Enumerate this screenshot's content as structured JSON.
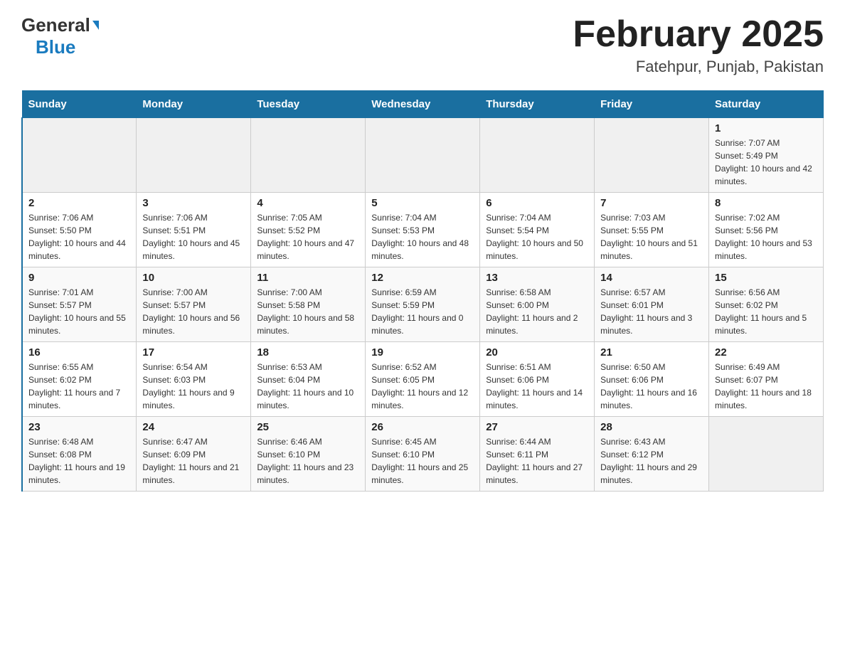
{
  "header": {
    "logo_line1": "General",
    "logo_line2": "Blue",
    "title": "February 2025",
    "subtitle": "Fatehpur, Punjab, Pakistan"
  },
  "calendar": {
    "days_of_week": [
      "Sunday",
      "Monday",
      "Tuesday",
      "Wednesday",
      "Thursday",
      "Friday",
      "Saturday"
    ],
    "weeks": [
      [
        {
          "day": "",
          "sunrise": "",
          "sunset": "",
          "daylight": ""
        },
        {
          "day": "",
          "sunrise": "",
          "sunset": "",
          "daylight": ""
        },
        {
          "day": "",
          "sunrise": "",
          "sunset": "",
          "daylight": ""
        },
        {
          "day": "",
          "sunrise": "",
          "sunset": "",
          "daylight": ""
        },
        {
          "day": "",
          "sunrise": "",
          "sunset": "",
          "daylight": ""
        },
        {
          "day": "",
          "sunrise": "",
          "sunset": "",
          "daylight": ""
        },
        {
          "day": "1",
          "sunrise": "Sunrise: 7:07 AM",
          "sunset": "Sunset: 5:49 PM",
          "daylight": "Daylight: 10 hours and 42 minutes."
        }
      ],
      [
        {
          "day": "2",
          "sunrise": "Sunrise: 7:06 AM",
          "sunset": "Sunset: 5:50 PM",
          "daylight": "Daylight: 10 hours and 44 minutes."
        },
        {
          "day": "3",
          "sunrise": "Sunrise: 7:06 AM",
          "sunset": "Sunset: 5:51 PM",
          "daylight": "Daylight: 10 hours and 45 minutes."
        },
        {
          "day": "4",
          "sunrise": "Sunrise: 7:05 AM",
          "sunset": "Sunset: 5:52 PM",
          "daylight": "Daylight: 10 hours and 47 minutes."
        },
        {
          "day": "5",
          "sunrise": "Sunrise: 7:04 AM",
          "sunset": "Sunset: 5:53 PM",
          "daylight": "Daylight: 10 hours and 48 minutes."
        },
        {
          "day": "6",
          "sunrise": "Sunrise: 7:04 AM",
          "sunset": "Sunset: 5:54 PM",
          "daylight": "Daylight: 10 hours and 50 minutes."
        },
        {
          "day": "7",
          "sunrise": "Sunrise: 7:03 AM",
          "sunset": "Sunset: 5:55 PM",
          "daylight": "Daylight: 10 hours and 51 minutes."
        },
        {
          "day": "8",
          "sunrise": "Sunrise: 7:02 AM",
          "sunset": "Sunset: 5:56 PM",
          "daylight": "Daylight: 10 hours and 53 minutes."
        }
      ],
      [
        {
          "day": "9",
          "sunrise": "Sunrise: 7:01 AM",
          "sunset": "Sunset: 5:57 PM",
          "daylight": "Daylight: 10 hours and 55 minutes."
        },
        {
          "day": "10",
          "sunrise": "Sunrise: 7:00 AM",
          "sunset": "Sunset: 5:57 PM",
          "daylight": "Daylight: 10 hours and 56 minutes."
        },
        {
          "day": "11",
          "sunrise": "Sunrise: 7:00 AM",
          "sunset": "Sunset: 5:58 PM",
          "daylight": "Daylight: 10 hours and 58 minutes."
        },
        {
          "day": "12",
          "sunrise": "Sunrise: 6:59 AM",
          "sunset": "Sunset: 5:59 PM",
          "daylight": "Daylight: 11 hours and 0 minutes."
        },
        {
          "day": "13",
          "sunrise": "Sunrise: 6:58 AM",
          "sunset": "Sunset: 6:00 PM",
          "daylight": "Daylight: 11 hours and 2 minutes."
        },
        {
          "day": "14",
          "sunrise": "Sunrise: 6:57 AM",
          "sunset": "Sunset: 6:01 PM",
          "daylight": "Daylight: 11 hours and 3 minutes."
        },
        {
          "day": "15",
          "sunrise": "Sunrise: 6:56 AM",
          "sunset": "Sunset: 6:02 PM",
          "daylight": "Daylight: 11 hours and 5 minutes."
        }
      ],
      [
        {
          "day": "16",
          "sunrise": "Sunrise: 6:55 AM",
          "sunset": "Sunset: 6:02 PM",
          "daylight": "Daylight: 11 hours and 7 minutes."
        },
        {
          "day": "17",
          "sunrise": "Sunrise: 6:54 AM",
          "sunset": "Sunset: 6:03 PM",
          "daylight": "Daylight: 11 hours and 9 minutes."
        },
        {
          "day": "18",
          "sunrise": "Sunrise: 6:53 AM",
          "sunset": "Sunset: 6:04 PM",
          "daylight": "Daylight: 11 hours and 10 minutes."
        },
        {
          "day": "19",
          "sunrise": "Sunrise: 6:52 AM",
          "sunset": "Sunset: 6:05 PM",
          "daylight": "Daylight: 11 hours and 12 minutes."
        },
        {
          "day": "20",
          "sunrise": "Sunrise: 6:51 AM",
          "sunset": "Sunset: 6:06 PM",
          "daylight": "Daylight: 11 hours and 14 minutes."
        },
        {
          "day": "21",
          "sunrise": "Sunrise: 6:50 AM",
          "sunset": "Sunset: 6:06 PM",
          "daylight": "Daylight: 11 hours and 16 minutes."
        },
        {
          "day": "22",
          "sunrise": "Sunrise: 6:49 AM",
          "sunset": "Sunset: 6:07 PM",
          "daylight": "Daylight: 11 hours and 18 minutes."
        }
      ],
      [
        {
          "day": "23",
          "sunrise": "Sunrise: 6:48 AM",
          "sunset": "Sunset: 6:08 PM",
          "daylight": "Daylight: 11 hours and 19 minutes."
        },
        {
          "day": "24",
          "sunrise": "Sunrise: 6:47 AM",
          "sunset": "Sunset: 6:09 PM",
          "daylight": "Daylight: 11 hours and 21 minutes."
        },
        {
          "day": "25",
          "sunrise": "Sunrise: 6:46 AM",
          "sunset": "Sunset: 6:10 PM",
          "daylight": "Daylight: 11 hours and 23 minutes."
        },
        {
          "day": "26",
          "sunrise": "Sunrise: 6:45 AM",
          "sunset": "Sunset: 6:10 PM",
          "daylight": "Daylight: 11 hours and 25 minutes."
        },
        {
          "day": "27",
          "sunrise": "Sunrise: 6:44 AM",
          "sunset": "Sunset: 6:11 PM",
          "daylight": "Daylight: 11 hours and 27 minutes."
        },
        {
          "day": "28",
          "sunrise": "Sunrise: 6:43 AM",
          "sunset": "Sunset: 6:12 PM",
          "daylight": "Daylight: 11 hours and 29 minutes."
        },
        {
          "day": "",
          "sunrise": "",
          "sunset": "",
          "daylight": ""
        }
      ]
    ]
  }
}
